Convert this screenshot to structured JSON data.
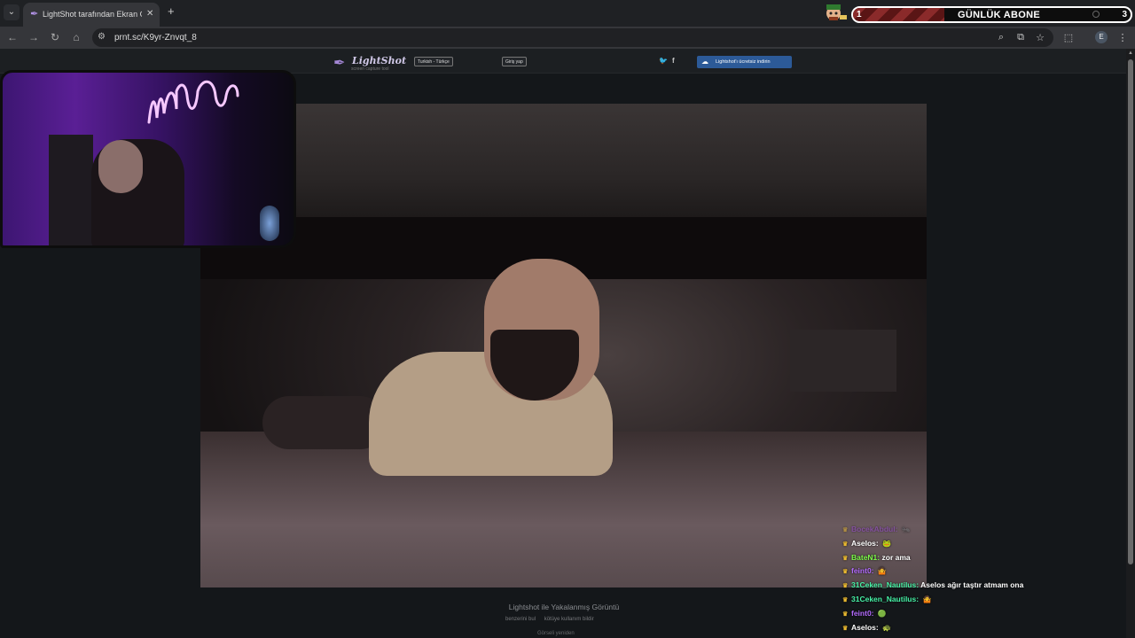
{
  "browser": {
    "tab_title": "LightShot tarafından Ekran Görüntüsü",
    "url": "prnt.sc/K9yr-Znvqt_8",
    "profile_initial": "E"
  },
  "overlay": {
    "sub_goal_label": "GÜNLÜK ABONE",
    "sub_goal_current": "1",
    "sub_goal_target": "3",
    "sub_goal_progress": 0.33
  },
  "lightshot": {
    "logo_name": "LightShot",
    "logo_tagline": "screen capture tool",
    "language_button": "Turkish - Türkçe",
    "login_button": "Giriş yap",
    "download_button": "Lightshot'ı ücretsiz indirin",
    "caption": "Lightshot ile Yakalanmış Görüntü",
    "link_similar": "benzerini bul",
    "link_report": "kötüye kullanım bildir",
    "link_more": "Görseli yeniden"
  },
  "chat": {
    "messages": [
      {
        "user": "BocekAbdul",
        "text": "",
        "color": "#9b4ad4",
        "faded": true,
        "emote": "🐜"
      },
      {
        "user": "Aselos",
        "text": "",
        "color": "#ffffff",
        "faded": false,
        "emote": "🐸"
      },
      {
        "user": "BateN1",
        "text": "zor ama",
        "color": "#7cfc48",
        "faded": false,
        "emote": ""
      },
      {
        "user": "feint0",
        "text": "",
        "color": "#b46cff",
        "faded": false,
        "emote": "🤷"
      },
      {
        "user": "31Ceken_Nautilus",
        "text": "Aselos ağır taştır atmam ona",
        "color": "#46f2a6",
        "faded": false,
        "emote": ""
      },
      {
        "user": "31Ceken_Nautilus",
        "text": "",
        "color": "#46f2a6",
        "faded": false,
        "emote": "🤷"
      },
      {
        "user": "feint0",
        "text": "",
        "color": "#b46cff",
        "faded": false,
        "emote": "🟢"
      },
      {
        "user": "Aselos",
        "text": "",
        "color": "#ffffff",
        "faded": false,
        "emote": "🐢"
      }
    ]
  }
}
